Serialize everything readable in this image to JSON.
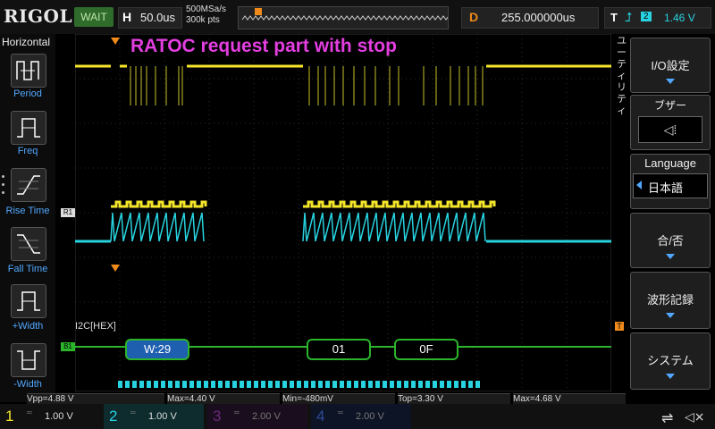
{
  "brand": "RIGOL",
  "status": "WAIT",
  "timebase": {
    "key": "H",
    "value": "50.0us"
  },
  "acquisition": {
    "rate": "500MSa/s",
    "points": "300k pts"
  },
  "delay": {
    "key": "D",
    "value": "255.000000us"
  },
  "trigger": {
    "key": "T",
    "channel": "2",
    "level": "1.46 V"
  },
  "annotation": "RATOC request part with stop",
  "left_panel": {
    "title": "Horizontal",
    "items": [
      "Period",
      "Freq",
      "Rise Time",
      "Fall Time",
      "+Width",
      "-Width"
    ]
  },
  "right_panel": {
    "title": "ユーティリティ",
    "io": "I/O設定",
    "buzzer": "ブザー",
    "language_header": "Language",
    "language_value": "日本語",
    "pass_fail": "合/否",
    "waveform_record": "波形記録",
    "system": "システム"
  },
  "decode": {
    "label": "I2C[HEX]",
    "frames": [
      "W:29",
      "01",
      "0F"
    ]
  },
  "markers": {
    "ch1": "1",
    "ch2": "2",
    "bus": "B1",
    "ref": "R1"
  },
  "measurements": [
    "Vpp=4.88 V",
    "Max=4.40 V",
    "Min=-480mV",
    "Top=3.30 V",
    "Max=4.68 V"
  ],
  "channels": [
    {
      "num": "1",
      "scale": "1.00 V",
      "color": "#f5e62a"
    },
    {
      "num": "2",
      "scale": "1.00 V",
      "color": "#27d3e0"
    },
    {
      "num": "3",
      "scale": "2.00 V",
      "color": "#b14fd1"
    },
    {
      "num": "4",
      "scale": "2.00 V",
      "color": "#3c6ad9"
    }
  ],
  "colors": {
    "ch1": "#f5e62a",
    "ch2": "#27d3e0",
    "decode": "#2bb52b",
    "annotation": "#e33ee0",
    "accent": "#f08a1a"
  }
}
